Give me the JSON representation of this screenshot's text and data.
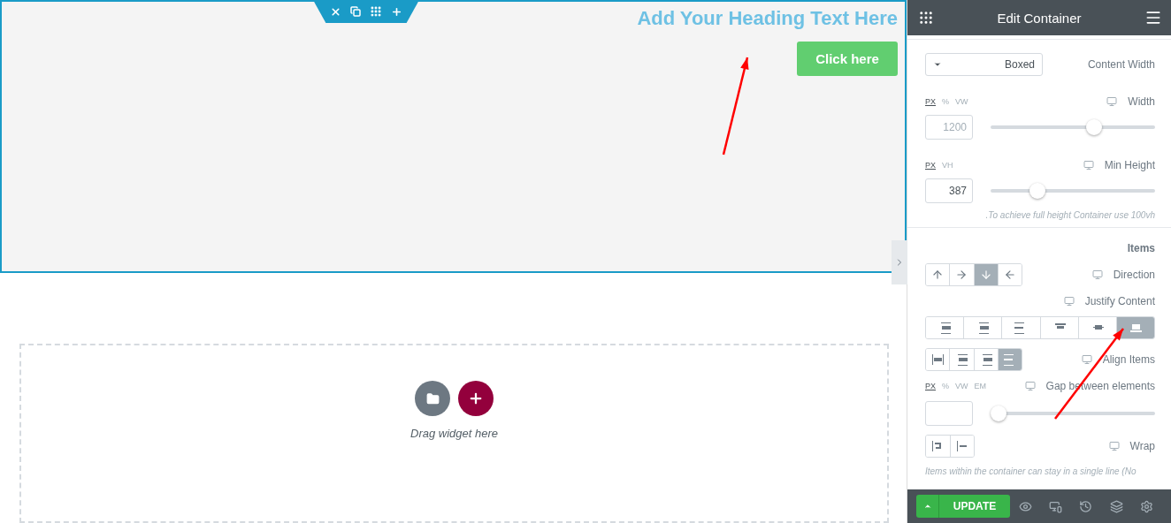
{
  "canvas": {
    "heading": "Add Your Heading Text Here",
    "button": "Click here",
    "drop_zone": {
      "hint": "Drag widget here"
    }
  },
  "panel": {
    "title": "Edit Container",
    "content_width": {
      "label": "Content Width",
      "value": "Boxed"
    },
    "width": {
      "label": "Width",
      "units": [
        {
          "label": "PX",
          "selected": true
        },
        {
          "label": "%",
          "selected": false
        },
        {
          "label": "VW",
          "selected": false
        }
      ],
      "placeholder": "1200",
      "level": 0.64
    },
    "min_height": {
      "label": "Min Height",
      "units": [
        {
          "label": "PX",
          "selected": true
        },
        {
          "label": "VH",
          "selected": false
        }
      ],
      "value": "387",
      "level": 0.26
    },
    "min_height_note": ".To achieve full height Container use 100vh",
    "items_heading": "Items",
    "direction": {
      "label": "Direction",
      "options": [
        {
          "kind": "up",
          "selected": false
        },
        {
          "kind": "right",
          "selected": false
        },
        {
          "kind": "down",
          "selected": true
        },
        {
          "kind": "left",
          "selected": false
        }
      ]
    },
    "justify_content": {
      "label": "Justify Content",
      "options": [
        {
          "kind": "start",
          "selected": false
        },
        {
          "kind": "center",
          "selected": false
        },
        {
          "kind": "end",
          "selected": false
        },
        {
          "kind": "between",
          "selected": false
        },
        {
          "kind": "around",
          "selected": false
        },
        {
          "kind": "evenly",
          "selected": true
        }
      ]
    },
    "align_items": {
      "label": "Align Items",
      "options": [
        {
          "kind": "stretch",
          "selected": false
        },
        {
          "kind": "start",
          "selected": false
        },
        {
          "kind": "center",
          "selected": false
        },
        {
          "kind": "end",
          "selected": true
        }
      ]
    },
    "gap": {
      "label": "Gap between elements",
      "units": [
        {
          "label": "PX",
          "selected": true
        },
        {
          "label": "%",
          "selected": false
        },
        {
          "label": "VW",
          "selected": false
        },
        {
          "label": "EM",
          "selected": false
        }
      ],
      "level": 0
    },
    "wrap": {
      "label": "Wrap",
      "options": [
        {
          "kind": "wrap",
          "selected": false
        },
        {
          "kind": "nowrap",
          "selected": false
        }
      ]
    },
    "wrap_note": "Items within the container can stay in a single line (No",
    "footer": {
      "update": "UPDATE"
    }
  }
}
